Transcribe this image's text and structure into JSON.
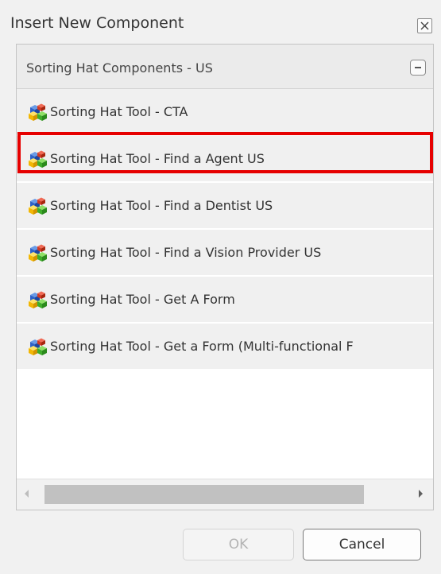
{
  "dialog": {
    "title": "Insert New Component"
  },
  "panel": {
    "header": "Sorting Hat Components - US",
    "items": [
      {
        "label": "Sorting Hat Tool - CTA"
      },
      {
        "label": "Sorting Hat Tool - Find a Agent US"
      },
      {
        "label": "Sorting Hat Tool - Find a Dentist US"
      },
      {
        "label": "Sorting Hat Tool - Find a Vision Provider US"
      },
      {
        "label": "Sorting Hat Tool - Get A Form"
      },
      {
        "label": "Sorting Hat Tool - Get a Form (Multi-functional F"
      }
    ],
    "selected_index": 1
  },
  "buttons": {
    "ok": "OK",
    "cancel": "Cancel"
  },
  "icons": {
    "close": "close-icon",
    "collapse": "minus-icon",
    "component": "component-blocks-icon",
    "scroll_left": "arrow-left-icon",
    "scroll_right": "arrow-right-icon"
  },
  "colors": {
    "highlight": "#e60000",
    "item_background": "#f0f0f0",
    "header_background": "#ebebeb",
    "dialog_background": "#f1f1f1"
  }
}
